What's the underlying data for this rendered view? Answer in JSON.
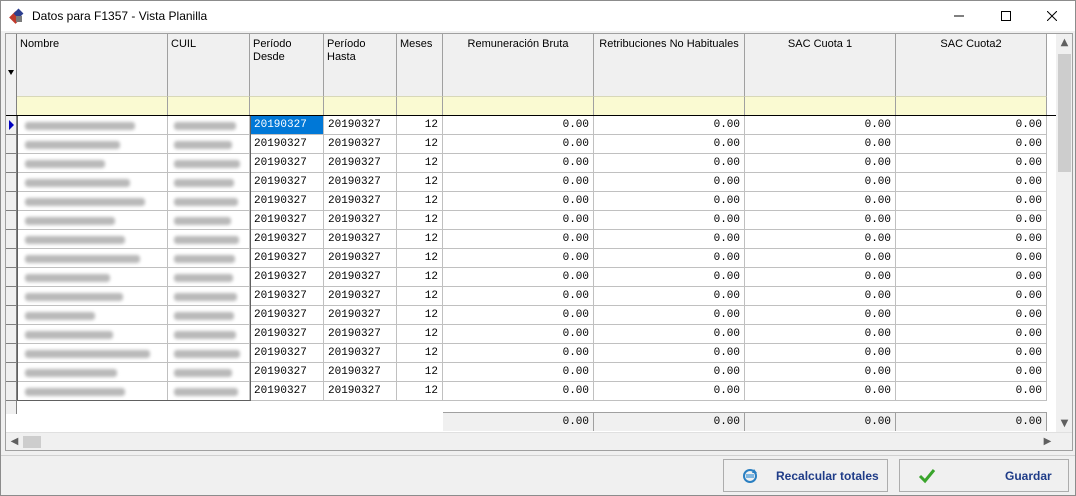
{
  "window": {
    "title": "Datos para F1357 - Vista Planilla",
    "icon": "app-logo-icon",
    "controls": [
      "minimize-icon",
      "maximize-icon",
      "close-icon"
    ]
  },
  "grid": {
    "columns": [
      {
        "key": "nombre",
        "label": "Nombre"
      },
      {
        "key": "cuil",
        "label": "CUIL"
      },
      {
        "key": "desde",
        "label": "Período\nDesde"
      },
      {
        "key": "hasta",
        "label": "Período\nHasta"
      },
      {
        "key": "meses",
        "label": "Meses"
      },
      {
        "key": "remuneracion",
        "label": "Remuneración Bruta"
      },
      {
        "key": "retribuciones",
        "label": "Retribuciones No Habituales"
      },
      {
        "key": "sac1",
        "label": "SAC Cuota 1"
      },
      {
        "key": "sac2",
        "label": "SAC Cuota2"
      }
    ],
    "rows": [
      {
        "desde": "20190327",
        "hasta": "20190327",
        "meses": "12",
        "remuneracion": "0.00",
        "retribuciones": "0.00",
        "sac1": "0.00",
        "sac2": "0.00"
      },
      {
        "desde": "20190327",
        "hasta": "20190327",
        "meses": "12",
        "remuneracion": "0.00",
        "retribuciones": "0.00",
        "sac1": "0.00",
        "sac2": "0.00"
      },
      {
        "desde": "20190327",
        "hasta": "20190327",
        "meses": "12",
        "remuneracion": "0.00",
        "retribuciones": "0.00",
        "sac1": "0.00",
        "sac2": "0.00"
      },
      {
        "desde": "20190327",
        "hasta": "20190327",
        "meses": "12",
        "remuneracion": "0.00",
        "retribuciones": "0.00",
        "sac1": "0.00",
        "sac2": "0.00"
      },
      {
        "desde": "20190327",
        "hasta": "20190327",
        "meses": "12",
        "remuneracion": "0.00",
        "retribuciones": "0.00",
        "sac1": "0.00",
        "sac2": "0.00"
      },
      {
        "desde": "20190327",
        "hasta": "20190327",
        "meses": "12",
        "remuneracion": "0.00",
        "retribuciones": "0.00",
        "sac1": "0.00",
        "sac2": "0.00"
      },
      {
        "desde": "20190327",
        "hasta": "20190327",
        "meses": "12",
        "remuneracion": "0.00",
        "retribuciones": "0.00",
        "sac1": "0.00",
        "sac2": "0.00"
      },
      {
        "desde": "20190327",
        "hasta": "20190327",
        "meses": "12",
        "remuneracion": "0.00",
        "retribuciones": "0.00",
        "sac1": "0.00",
        "sac2": "0.00"
      },
      {
        "desde": "20190327",
        "hasta": "20190327",
        "meses": "12",
        "remuneracion": "0.00",
        "retribuciones": "0.00",
        "sac1": "0.00",
        "sac2": "0.00"
      },
      {
        "desde": "20190327",
        "hasta": "20190327",
        "meses": "12",
        "remuneracion": "0.00",
        "retribuciones": "0.00",
        "sac1": "0.00",
        "sac2": "0.00"
      },
      {
        "desde": "20190327",
        "hasta": "20190327",
        "meses": "12",
        "remuneracion": "0.00",
        "retribuciones": "0.00",
        "sac1": "0.00",
        "sac2": "0.00"
      },
      {
        "desde": "20190327",
        "hasta": "20190327",
        "meses": "12",
        "remuneracion": "0.00",
        "retribuciones": "0.00",
        "sac1": "0.00",
        "sac2": "0.00"
      },
      {
        "desde": "20190327",
        "hasta": "20190327",
        "meses": "12",
        "remuneracion": "0.00",
        "retribuciones": "0.00",
        "sac1": "0.00",
        "sac2": "0.00"
      },
      {
        "desde": "20190327",
        "hasta": "20190327",
        "meses": "12",
        "remuneracion": "0.00",
        "retribuciones": "0.00",
        "sac1": "0.00",
        "sac2": "0.00"
      },
      {
        "desde": "20190327",
        "hasta": "20190327",
        "meses": "12",
        "remuneracion": "0.00",
        "retribuciones": "0.00",
        "sac1": "0.00",
        "sac2": "0.00"
      }
    ],
    "totals": {
      "remuneracion": "0.00",
      "retribuciones": "0.00",
      "sac1": "0.00",
      "sac2": "0.00"
    },
    "selected_row": 0
  },
  "buttons": {
    "recalcular": {
      "label": "Recalcular totales",
      "icon": "recalculate-icon"
    },
    "guardar": {
      "label": "Guardar",
      "icon": "checkmark-icon"
    }
  },
  "colors": {
    "selection": "#0078d7",
    "filter_row": "#fafad2",
    "button_text": "#1f3c88"
  }
}
